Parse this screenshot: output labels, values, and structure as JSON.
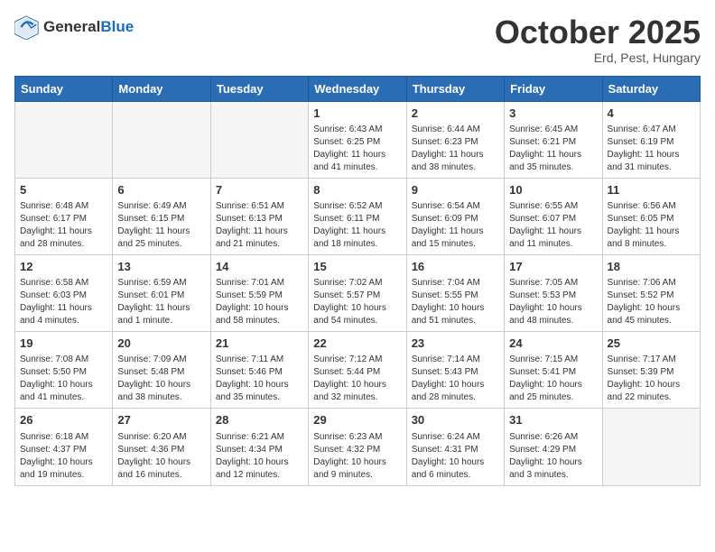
{
  "header": {
    "logo_general": "General",
    "logo_blue": "Blue",
    "month": "October 2025",
    "location": "Erd, Pest, Hungary"
  },
  "days_of_week": [
    "Sunday",
    "Monday",
    "Tuesday",
    "Wednesday",
    "Thursday",
    "Friday",
    "Saturday"
  ],
  "weeks": [
    [
      {
        "day": "",
        "info": ""
      },
      {
        "day": "",
        "info": ""
      },
      {
        "day": "",
        "info": ""
      },
      {
        "day": "1",
        "info": "Sunrise: 6:43 AM\nSunset: 6:25 PM\nDaylight: 11 hours\nand 41 minutes."
      },
      {
        "day": "2",
        "info": "Sunrise: 6:44 AM\nSunset: 6:23 PM\nDaylight: 11 hours\nand 38 minutes."
      },
      {
        "day": "3",
        "info": "Sunrise: 6:45 AM\nSunset: 6:21 PM\nDaylight: 11 hours\nand 35 minutes."
      },
      {
        "day": "4",
        "info": "Sunrise: 6:47 AM\nSunset: 6:19 PM\nDaylight: 11 hours\nand 31 minutes."
      }
    ],
    [
      {
        "day": "5",
        "info": "Sunrise: 6:48 AM\nSunset: 6:17 PM\nDaylight: 11 hours\nand 28 minutes."
      },
      {
        "day": "6",
        "info": "Sunrise: 6:49 AM\nSunset: 6:15 PM\nDaylight: 11 hours\nand 25 minutes."
      },
      {
        "day": "7",
        "info": "Sunrise: 6:51 AM\nSunset: 6:13 PM\nDaylight: 11 hours\nand 21 minutes."
      },
      {
        "day": "8",
        "info": "Sunrise: 6:52 AM\nSunset: 6:11 PM\nDaylight: 11 hours\nand 18 minutes."
      },
      {
        "day": "9",
        "info": "Sunrise: 6:54 AM\nSunset: 6:09 PM\nDaylight: 11 hours\nand 15 minutes."
      },
      {
        "day": "10",
        "info": "Sunrise: 6:55 AM\nSunset: 6:07 PM\nDaylight: 11 hours\nand 11 minutes."
      },
      {
        "day": "11",
        "info": "Sunrise: 6:56 AM\nSunset: 6:05 PM\nDaylight: 11 hours\nand 8 minutes."
      }
    ],
    [
      {
        "day": "12",
        "info": "Sunrise: 6:58 AM\nSunset: 6:03 PM\nDaylight: 11 hours\nand 4 minutes."
      },
      {
        "day": "13",
        "info": "Sunrise: 6:59 AM\nSunset: 6:01 PM\nDaylight: 11 hours\nand 1 minute."
      },
      {
        "day": "14",
        "info": "Sunrise: 7:01 AM\nSunset: 5:59 PM\nDaylight: 10 hours\nand 58 minutes."
      },
      {
        "day": "15",
        "info": "Sunrise: 7:02 AM\nSunset: 5:57 PM\nDaylight: 10 hours\nand 54 minutes."
      },
      {
        "day": "16",
        "info": "Sunrise: 7:04 AM\nSunset: 5:55 PM\nDaylight: 10 hours\nand 51 minutes."
      },
      {
        "day": "17",
        "info": "Sunrise: 7:05 AM\nSunset: 5:53 PM\nDaylight: 10 hours\nand 48 minutes."
      },
      {
        "day": "18",
        "info": "Sunrise: 7:06 AM\nSunset: 5:52 PM\nDaylight: 10 hours\nand 45 minutes."
      }
    ],
    [
      {
        "day": "19",
        "info": "Sunrise: 7:08 AM\nSunset: 5:50 PM\nDaylight: 10 hours\nand 41 minutes."
      },
      {
        "day": "20",
        "info": "Sunrise: 7:09 AM\nSunset: 5:48 PM\nDaylight: 10 hours\nand 38 minutes."
      },
      {
        "day": "21",
        "info": "Sunrise: 7:11 AM\nSunset: 5:46 PM\nDaylight: 10 hours\nand 35 minutes."
      },
      {
        "day": "22",
        "info": "Sunrise: 7:12 AM\nSunset: 5:44 PM\nDaylight: 10 hours\nand 32 minutes."
      },
      {
        "day": "23",
        "info": "Sunrise: 7:14 AM\nSunset: 5:43 PM\nDaylight: 10 hours\nand 28 minutes."
      },
      {
        "day": "24",
        "info": "Sunrise: 7:15 AM\nSunset: 5:41 PM\nDaylight: 10 hours\nand 25 minutes."
      },
      {
        "day": "25",
        "info": "Sunrise: 7:17 AM\nSunset: 5:39 PM\nDaylight: 10 hours\nand 22 minutes."
      }
    ],
    [
      {
        "day": "26",
        "info": "Sunrise: 6:18 AM\nSunset: 4:37 PM\nDaylight: 10 hours\nand 19 minutes."
      },
      {
        "day": "27",
        "info": "Sunrise: 6:20 AM\nSunset: 4:36 PM\nDaylight: 10 hours\nand 16 minutes."
      },
      {
        "day": "28",
        "info": "Sunrise: 6:21 AM\nSunset: 4:34 PM\nDaylight: 10 hours\nand 12 minutes."
      },
      {
        "day": "29",
        "info": "Sunrise: 6:23 AM\nSunset: 4:32 PM\nDaylight: 10 hours\nand 9 minutes."
      },
      {
        "day": "30",
        "info": "Sunrise: 6:24 AM\nSunset: 4:31 PM\nDaylight: 10 hours\nand 6 minutes."
      },
      {
        "day": "31",
        "info": "Sunrise: 6:26 AM\nSunset: 4:29 PM\nDaylight: 10 hours\nand 3 minutes."
      },
      {
        "day": "",
        "info": ""
      }
    ]
  ]
}
